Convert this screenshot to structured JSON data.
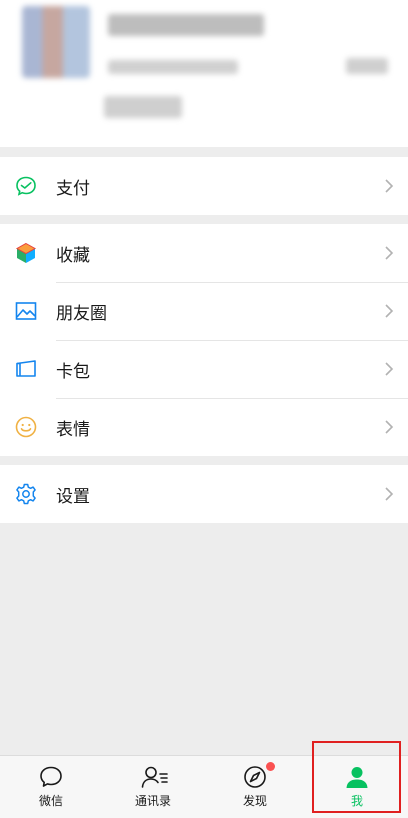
{
  "menu": {
    "pay": "支付",
    "favorites": "收藏",
    "moments": "朋友圈",
    "cards": "卡包",
    "stickers": "表情",
    "settings": "设置"
  },
  "tabbar": {
    "chats": "微信",
    "contacts": "通讯录",
    "discover": "发现",
    "me": "我"
  },
  "colors": {
    "accent_green": "#07c160",
    "badge_red": "#fa5151",
    "highlight_border": "#e02020"
  }
}
